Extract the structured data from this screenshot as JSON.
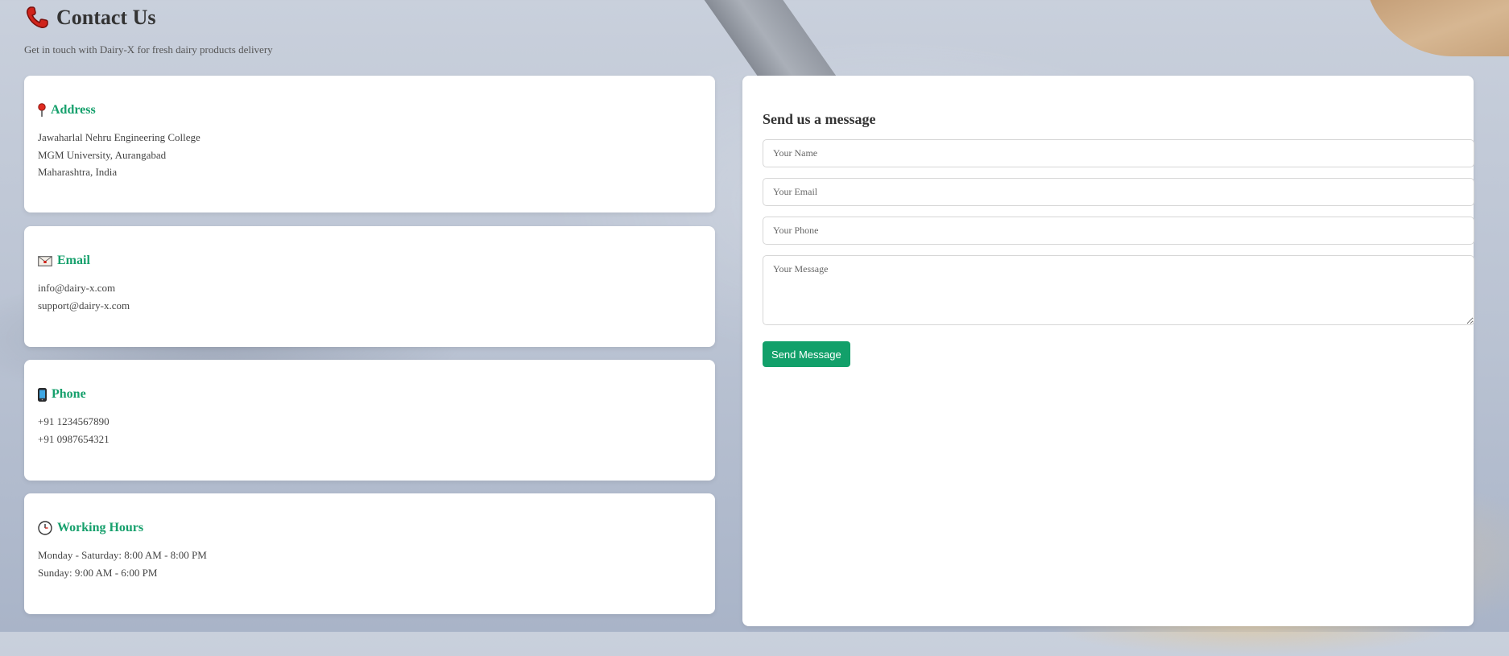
{
  "header": {
    "title": "Contact Us",
    "subtitle": "Get in touch with Dairy-X for fresh dairy products delivery",
    "icon": "phone-icon"
  },
  "cards": [
    {
      "heading": "Address",
      "icon": "map-pin-icon",
      "lines": [
        "Jawaharlal Nehru Engineering College",
        "MGM University, Aurangabad",
        "Maharashtra, India"
      ]
    },
    {
      "heading": "Email",
      "icon": "envelope-icon",
      "lines": [
        "info@dairy-x.com",
        "support@dairy-x.com"
      ]
    },
    {
      "heading": "Phone",
      "icon": "mobile-phone-icon",
      "lines": [
        "+91 1234567890",
        "+91 0987654321"
      ]
    },
    {
      "heading": "Working Hours",
      "icon": "clock-icon",
      "lines": [
        "Monday - Saturday: 8:00 AM - 8:00 PM",
        "Sunday: 9:00 AM - 6:00 PM"
      ]
    }
  ],
  "form": {
    "title": "Send us a message",
    "name_placeholder": "Your Name",
    "email_placeholder": "Your Email",
    "phone_placeholder": "Your Phone",
    "message_placeholder": "Your Message",
    "submit_label": "Send Message"
  },
  "colors": {
    "accent": "#16a06c",
    "button": "#12a06a",
    "title_icon": "#d0231b"
  }
}
